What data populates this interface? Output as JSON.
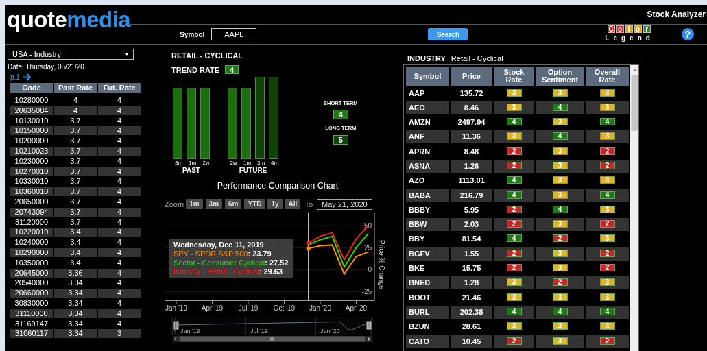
{
  "header": {
    "logo_left": "quote",
    "logo_right": "media",
    "app_title": "Stock Analyzer",
    "symbol_label": "Symbol",
    "symbol_value": "AAPL",
    "search_button": "Search",
    "legend_letters": [
      {
        "text": "C",
        "color": "#c62828"
      },
      {
        "text": "o",
        "color": "#c62828"
      },
      {
        "text": "l",
        "color": "#d4a017"
      },
      {
        "text": "o",
        "color": "#d4a017"
      },
      {
        "text": "r",
        "color": "#2e7d32"
      }
    ],
    "legend_word": "Legend",
    "help": "?"
  },
  "left": {
    "region_select": "USA - Industry",
    "date": "Date: Thursday, 05/21/20",
    "page": "p.1",
    "columns": [
      "Code",
      "Past Rate",
      "Fut. Rate"
    ],
    "rows": [
      [
        "10280000",
        "4",
        "4"
      ],
      [
        "20635084",
        "4",
        "4"
      ],
      [
        "10130010",
        "3.7",
        "4"
      ],
      [
        "10150000",
        "3.7",
        "4"
      ],
      [
        "10200000",
        "3.7",
        "4"
      ],
      [
        "10210023",
        "3.7",
        "4"
      ],
      [
        "10230000",
        "3.7",
        "4"
      ],
      [
        "10270010",
        "3.7",
        "4"
      ],
      [
        "10330010",
        "3.7",
        "4"
      ],
      [
        "10360010",
        "3.7",
        "4"
      ],
      [
        "20650000",
        "3.7",
        "4"
      ],
      [
        "20743094",
        "3.7",
        "4"
      ],
      [
        "31120000",
        "3.7",
        "4"
      ],
      [
        "10220010",
        "3.4",
        "4"
      ],
      [
        "10240000",
        "3.4",
        "4"
      ],
      [
        "10290000",
        "3.4",
        "4"
      ],
      [
        "10350000",
        "3.4",
        "4"
      ],
      [
        "20645000",
        "3.36",
        "4"
      ],
      [
        "20540000",
        "3.34",
        "4"
      ],
      [
        "20660000",
        "3.34",
        "4"
      ],
      [
        "30830000",
        "3.34",
        "4"
      ],
      [
        "31110000",
        "3.34",
        "4"
      ],
      [
        "31169147",
        "3.34",
        "4"
      ],
      [
        "31060117",
        "3.34",
        "3"
      ]
    ]
  },
  "trend": {
    "title": "RETAIL - CYCLICAL",
    "trend_label": "TREND RATE",
    "trend_value": "4",
    "groups": [
      {
        "label": "PAST",
        "bars": [
          {
            "label": "3m",
            "kind": "short",
            "color": "#1c6e10"
          },
          {
            "label": "1m",
            "kind": "short",
            "color": "#1c6e10"
          },
          {
            "label": "2w",
            "kind": "short",
            "color": "#1c6e10"
          }
        ]
      },
      {
        "label": "FUTURE",
        "bars": [
          {
            "label": "2w",
            "kind": "short",
            "color": "#1c6e10"
          },
          {
            "label": "1m",
            "kind": "short",
            "color": "#1c6e10"
          },
          {
            "label": "3m",
            "kind": "tall",
            "color": "#11420a"
          },
          {
            "label": "4m",
            "kind": "tall",
            "color": "#11420a"
          }
        ]
      }
    ],
    "terms": [
      {
        "label": "SHORT TERM",
        "value": "4",
        "color": "#1e7a12"
      },
      {
        "label": "LONG TERM",
        "value": "5",
        "color": "#11420a"
      }
    ]
  },
  "performance": {
    "title": "Performance Comparison Chart",
    "zoom_label": "Zoom",
    "zoom_buttons": [
      "1m",
      "3m",
      "6m",
      "YTD",
      "1y",
      "All"
    ],
    "to_label": "To",
    "to_date": "May 21, 2020",
    "chart_data": {
      "type": "line",
      "ylabel": "Price % Change",
      "grid": true,
      "categories": [
        "Jan '19",
        null,
        null,
        "Apr '19",
        null,
        null,
        "Jul '19",
        null,
        null,
        "Oct '19",
        null,
        null,
        "Jan '20",
        null,
        null,
        "Apr '20",
        null
      ],
      "yticks": [
        -25,
        0,
        25,
        50
      ],
      "ylim": [
        -35,
        65
      ],
      "series": [
        {
          "name": "SPY - SPDR S&P 500",
          "color": "#ff8c00",
          "values": [
            null,
            null,
            null,
            null,
            null,
            null,
            null,
            null,
            null,
            null,
            null,
            24,
            27,
            28,
            -5,
            15,
            20
          ]
        },
        {
          "name": "Sector - Consumer Cyclical",
          "color": "#22dd00",
          "values": [
            null,
            null,
            null,
            null,
            null,
            null,
            null,
            null,
            null,
            null,
            null,
            28,
            34,
            38,
            3,
            25,
            41
          ]
        },
        {
          "name": "Industry - Retail - Cyclical",
          "color": "#ff1a1a",
          "values": [
            null,
            null,
            null,
            null,
            null,
            null,
            null,
            null,
            null,
            null,
            null,
            30,
            38,
            42,
            11,
            35,
            50
          ]
        }
      ]
    },
    "tooltip": {
      "title": "Wednesday, Dec 11, 2019",
      "values": [
        ": 23.79",
        ": 27.52",
        ": 29.63"
      ]
    },
    "navigator_labels": [
      "Jan '19",
      "Jul '19",
      "Jan '20"
    ]
  },
  "industry": {
    "label": "INDUSTRY",
    "name": "Retail - Cyclical",
    "columns": [
      "Symbol",
      "Price",
      "Stock Rate",
      "Option Sentiment",
      "Overall Rate"
    ],
    "rows": [
      {
        "symbol": "AAP",
        "price": "135.72",
        "rates": [
          {
            "text": "3",
            "color": "#e0b428"
          },
          {
            "text": "3",
            "color": "#e0b428"
          },
          {
            "text": "3",
            "color": "#e0b428"
          }
        ]
      },
      {
        "symbol": "AEO",
        "price": "8.46",
        "rates": [
          {
            "text": "3",
            "color": "#e0b428"
          },
          {
            "text": "4",
            "color": "#1e7a12"
          },
          {
            "text": "3",
            "color": "#e0b428"
          }
        ]
      },
      {
        "symbol": "AMZN",
        "price": "2497.94",
        "rates": [
          {
            "text": "4",
            "color": "#1e7a12"
          },
          {
            "text": "3",
            "color": "#e0b428"
          },
          {
            "text": "4",
            "color": "#1e7a12"
          }
        ]
      },
      {
        "symbol": "ANF",
        "price": "11.36",
        "rates": [
          {
            "text": "3",
            "color": "#e0b428"
          },
          {
            "text": "4",
            "color": "#1e7a12"
          },
          {
            "text": "3",
            "color": "#e0b428"
          }
        ]
      },
      {
        "symbol": "APRN",
        "price": "8.48",
        "rates": [
          {
            "text": "2",
            "color": "#c62828"
          },
          {
            "text": "3",
            "color": "#e0b428"
          },
          {
            "text": "2",
            "color": "#c62828"
          }
        ]
      },
      {
        "symbol": "ASNA",
        "price": "1.26",
        "rates": [
          {
            "text": "2",
            "color": "#c62828"
          },
          {
            "text": "3",
            "color": "#e0b428"
          },
          {
            "text": "2",
            "color": "#c62828"
          }
        ]
      },
      {
        "symbol": "AZO",
        "price": "1113.01",
        "rates": [
          {
            "text": "4",
            "color": "#1e7a12"
          },
          {
            "text": "3",
            "color": "#e0b428"
          },
          {
            "text": "3",
            "color": "#e0b428"
          }
        ]
      },
      {
        "symbol": "BABA",
        "price": "216.79",
        "rates": [
          {
            "text": "4",
            "color": "#1e7a12"
          },
          {
            "text": "3",
            "color": "#e0b428"
          },
          {
            "text": "4",
            "color": "#1e7a12"
          }
        ]
      },
      {
        "symbol": "BBBY",
        "price": "5.95",
        "rates": [
          {
            "text": "2",
            "color": "#c62828"
          },
          {
            "text": "4",
            "color": "#1e7a12"
          },
          {
            "text": "3",
            "color": "#e0b428"
          }
        ]
      },
      {
        "symbol": "BBW",
        "price": "2.03",
        "rates": [
          {
            "text": "2",
            "color": "#c62828"
          },
          {
            "text": "3",
            "color": "#e0b428"
          },
          {
            "text": "2",
            "color": "#c62828"
          }
        ]
      },
      {
        "symbol": "BBY",
        "price": "81.54",
        "rates": [
          {
            "text": "4",
            "color": "#1e7a12"
          },
          {
            "text": "2",
            "color": "#c62828"
          },
          {
            "text": "3",
            "color": "#e0b428"
          }
        ]
      },
      {
        "symbol": "BGFV",
        "price": "1.55",
        "rates": [
          {
            "text": "2",
            "color": "#c62828"
          },
          {
            "text": "3",
            "color": "#e0b428"
          },
          {
            "text": "2",
            "color": "#c62828"
          }
        ]
      },
      {
        "symbol": "BKE",
        "price": "15.75",
        "rates": [
          {
            "text": "2",
            "color": "#c62828"
          },
          {
            "text": "3",
            "color": "#e0b428"
          },
          {
            "text": "2",
            "color": "#c62828"
          }
        ]
      },
      {
        "symbol": "BNED",
        "price": "1.28",
        "rates": [
          {
            "text": "3",
            "color": "#e0b428"
          },
          {
            "text": "2",
            "color": "#c62828"
          },
          {
            "text": "3",
            "color": "#e0b428"
          }
        ]
      },
      {
        "symbol": "BOOT",
        "price": "21.46",
        "rates": [
          {
            "text": "3",
            "color": "#e0b428"
          },
          {
            "text": "3",
            "color": "#e0b428"
          },
          {
            "text": "3",
            "color": "#e0b428"
          }
        ]
      },
      {
        "symbol": "BURL",
        "price": "202.38",
        "rates": [
          {
            "text": "4",
            "color": "#1e7a12"
          },
          {
            "text": "4",
            "color": "#1e7a12"
          },
          {
            "text": "4",
            "color": "#1e7a12"
          }
        ]
      },
      {
        "symbol": "BZUN",
        "price": "28.61",
        "rates": [
          {
            "text": "3",
            "color": "#e0b428"
          },
          {
            "text": "3",
            "color": "#e0b428"
          },
          {
            "text": "3",
            "color": "#e0b428"
          }
        ]
      },
      {
        "symbol": "CATO",
        "price": "10.45",
        "rates": [
          {
            "text": "2",
            "color": "#c62828"
          },
          {
            "text": "3",
            "color": "#e0b428"
          },
          {
            "text": "2",
            "color": "#c62828"
          }
        ]
      }
    ]
  }
}
